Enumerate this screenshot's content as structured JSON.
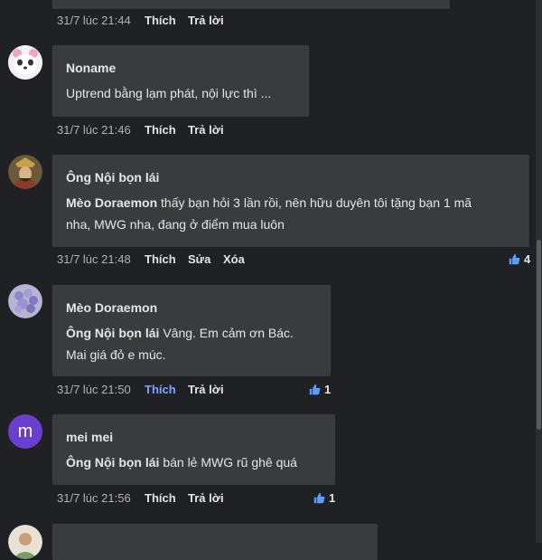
{
  "comments": [
    {
      "timestamp": "31/7 lúc 21:44",
      "actions": [
        "Thích",
        "Trả lời"
      ]
    },
    {
      "author": "Noname",
      "mention": "",
      "lines": [
        "Uptrend bằng lạm phát, nội lực thì ..."
      ],
      "timestamp": "31/7 lúc 21:46",
      "actions": [
        "Thích",
        "Trả lời"
      ],
      "avatar_icon": "panda-avatar-icon"
    },
    {
      "author": "Ông Nội bọn lái",
      "mention": "Mèo Doraemon",
      "lines": [
        " thấy bạn hỏi 3 lần rồi, nên hữu duyên tôi tặng bạn 1 mã",
        "nha, MWG nha, đang ở điểm mua luôn"
      ],
      "timestamp": "31/7 lúc 21:48",
      "actions": [
        "Thích",
        "Sửa",
        "Xóa"
      ],
      "likes": "4",
      "avatar_icon": "warrior-avatar-icon"
    },
    {
      "author": "Mèo Doraemon",
      "mention": "Ông Nội bọn lái",
      "lines": [
        " Vâng. Em cảm ơn Bác.",
        "Mai giá đỏ e múc."
      ],
      "timestamp": "31/7 lúc 21:50",
      "actions": [
        "Thích",
        "Trả lời"
      ],
      "liked_action_active": true,
      "likes": "1",
      "avatar_icon": "flower-avatar-icon"
    },
    {
      "author": "mei mei",
      "mention": "Ông Nội bọn lái",
      "lines": [
        " bán lẻ MWG rũ ghê quá"
      ],
      "timestamp": "31/7 lúc 21:56",
      "actions": [
        "Thích",
        "Trả lời"
      ],
      "likes": "1",
      "avatar_letter": "m",
      "avatar_color": "#6a3fd0"
    },
    {
      "avatar_icon": "person-avatar-icon"
    }
  ],
  "colors": {
    "background": "#202124",
    "bubble": "#3a3b3c",
    "meta_text": "#b0b3b8",
    "active_like": "#7aa7ff",
    "like_icon": "#5b9cff"
  }
}
